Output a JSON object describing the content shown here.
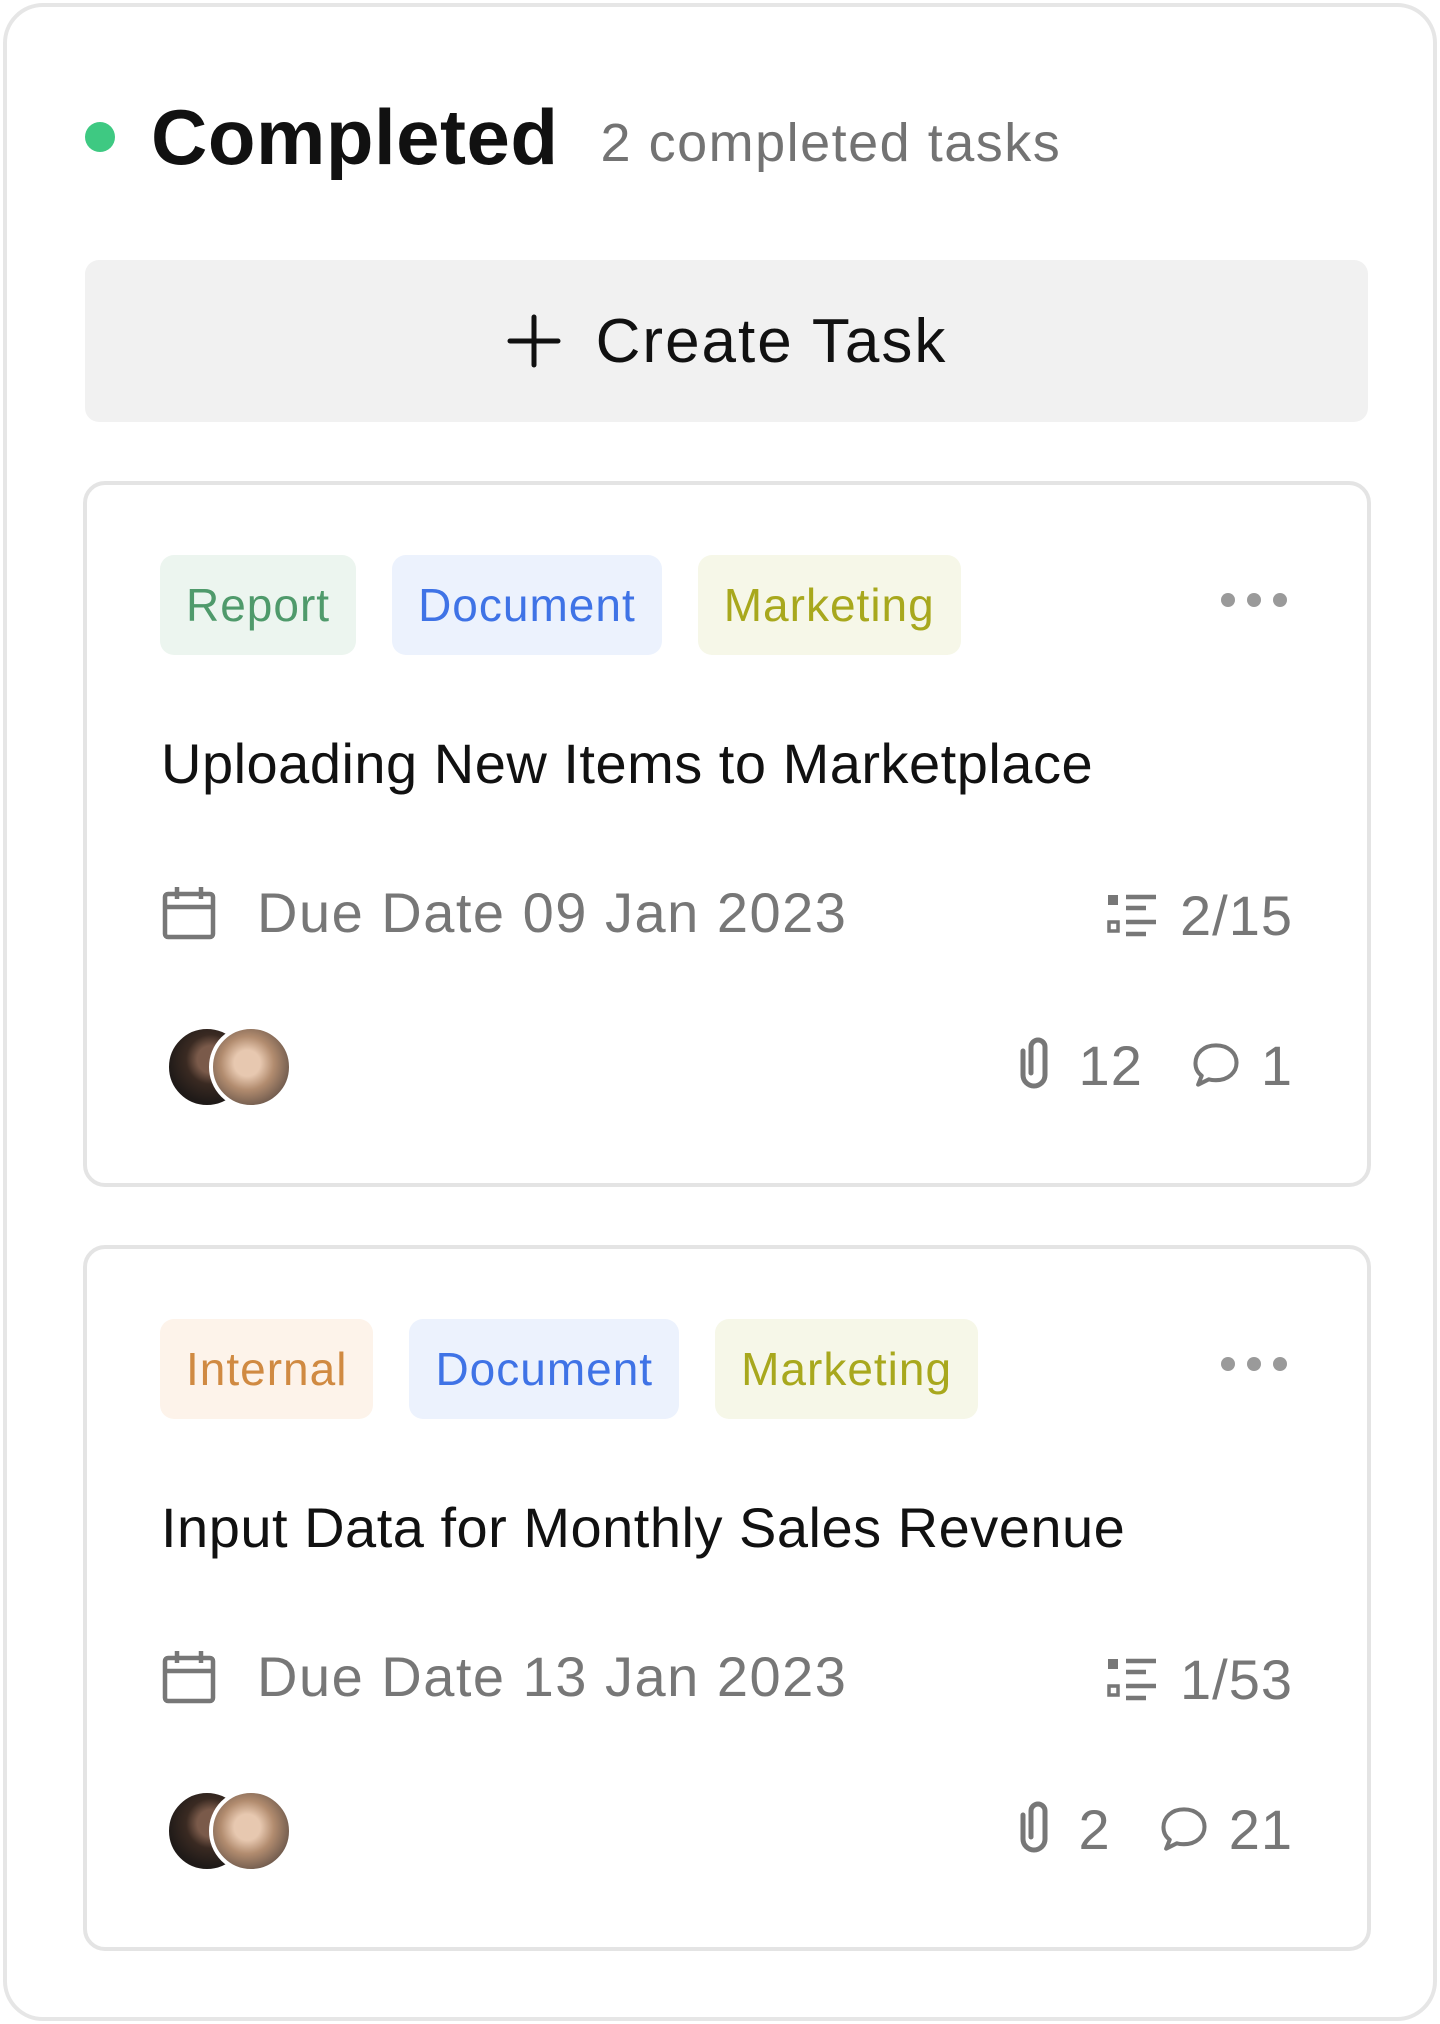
{
  "column": {
    "title": "Completed",
    "count_text": "2 completed tasks",
    "status_color": "#3ec982",
    "create_label": "Create Task"
  },
  "cards": [
    {
      "tags": [
        {
          "label": "Report",
          "kind": "report"
        },
        {
          "label": "Document",
          "kind": "document"
        },
        {
          "label": "Marketing",
          "kind": "marketing"
        }
      ],
      "title": "Uploading New Items to Marketplace",
      "due": "Due Date 09 Jan 2023",
      "subtasks": "2/15",
      "attachments": "12",
      "comments": "1"
    },
    {
      "tags": [
        {
          "label": "Internal",
          "kind": "internal"
        },
        {
          "label": "Document",
          "kind": "document"
        },
        {
          "label": "Marketing",
          "kind": "marketing"
        }
      ],
      "title": "Input Data for Monthly Sales Revenue",
      "due": "Due Date 13 Jan 2023",
      "subtasks": "1/53",
      "attachments": "2",
      "comments": "21"
    }
  ],
  "icons": {
    "plus": "plus-icon",
    "more": "more-horizontal-icon",
    "calendar": "calendar-icon",
    "subtasks": "checklist-icon",
    "attachment": "paperclip-icon",
    "comment": "comment-icon"
  }
}
